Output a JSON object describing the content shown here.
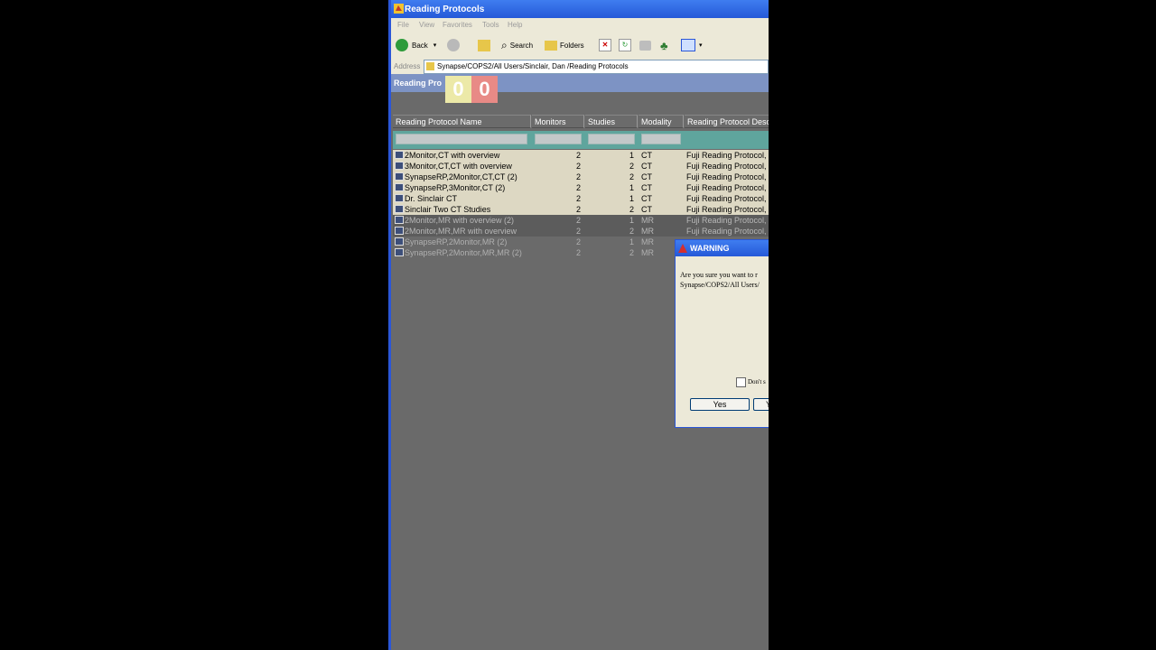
{
  "window": {
    "title": "Reading Protocols",
    "colors": {
      "titlebar": "#2559d8",
      "workspace": "#6a6a6a",
      "filter_row": "#5fa59d"
    }
  },
  "menu": [
    "File",
    "View",
    "Favorites",
    "Tools",
    "Help"
  ],
  "toolbar": {
    "back_label": "Back",
    "search_label": "Search",
    "folders_label": "Folders"
  },
  "address": {
    "label": "Address",
    "value": "Synapse/COPS2/All Users/Sinclair, Dan /Reading Protocols"
  },
  "header_strip": {
    "title": "Reading Pro"
  },
  "counters": [
    {
      "value": "0",
      "color": "#ece9a8"
    },
    {
      "value": "0",
      "color": "#e88a86"
    }
  ],
  "columns": [
    "Reading Protocol Name",
    "Monitors",
    "Studies",
    "Modality",
    "Reading Protocol Desc"
  ],
  "rows": [
    {
      "name": "2Monitor,CT with overview",
      "monitors": "2",
      "studies": "1",
      "modality": "CT",
      "description": "Fuji Reading Protocol,",
      "highlight": "light"
    },
    {
      "name": "3Monitor,CT,CT with overview",
      "monitors": "2",
      "studies": "2",
      "modality": "CT",
      "description": "Fuji Reading Protocol,",
      "highlight": "light"
    },
    {
      "name": "SynapseRP,2Monitor,CT,CT (2)",
      "monitors": "2",
      "studies": "2",
      "modality": "CT",
      "description": "Fuji Reading Protocol,",
      "highlight": "light"
    },
    {
      "name": "SynapseRP,3Monitor,CT (2)",
      "monitors": "2",
      "studies": "1",
      "modality": "CT",
      "description": "Fuji Reading Protocol,",
      "highlight": "light"
    },
    {
      "name": "Dr. Sinclair CT",
      "monitors": "2",
      "studies": "1",
      "modality": "CT",
      "description": "Fuji Reading Protocol,",
      "highlight": "light"
    },
    {
      "name": "Sinclair Two CT Studies",
      "monitors": "2",
      "studies": "2",
      "modality": "CT",
      "description": "Fuji Reading Protocol,",
      "highlight": "light"
    },
    {
      "name": "2Monitor,MR with overview (2)",
      "monitors": "2",
      "studies": "1",
      "modality": "MR",
      "description": "Fuji Reading Protocol,",
      "highlight": "dark"
    },
    {
      "name": "2Monitor,MR,MR with overview",
      "monitors": "2",
      "studies": "2",
      "modality": "MR",
      "description": "Fuji Reading Protocol,",
      "highlight": "dark"
    },
    {
      "name": "SynapseRP,2Monitor,MR (2)",
      "monitors": "2",
      "studies": "1",
      "modality": "MR",
      "description": "",
      "highlight": "none"
    },
    {
      "name": "SynapseRP,2Monitor,MR,MR (2)",
      "monitors": "2",
      "studies": "2",
      "modality": "MR",
      "description": "",
      "highlight": "none"
    }
  ],
  "dialog": {
    "title": "WARNING",
    "message_line1": "Are you sure you want to r",
    "message_line2": "Synapse/COPS2/All Users/",
    "checkbox_label": "Don't s",
    "yes_label": "Yes",
    "second_button_label": "Y"
  }
}
